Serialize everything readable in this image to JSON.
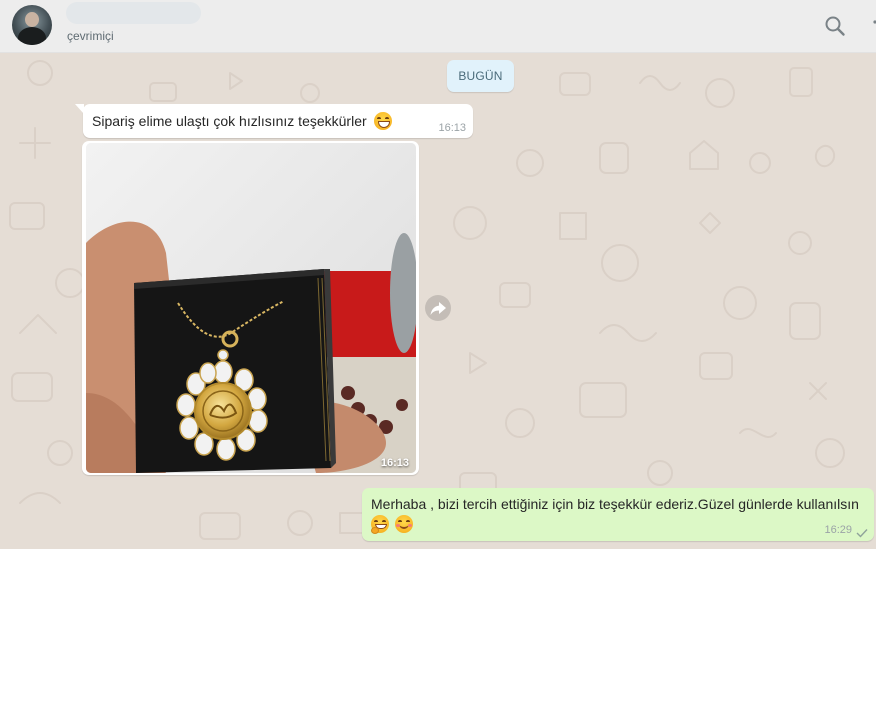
{
  "header": {
    "contact_status": "çevrimiçi",
    "search_icon": "search-icon",
    "menu_icon": "menu-icon"
  },
  "chat": {
    "date_label": "BUGÜN",
    "messages": [
      {
        "direction": "incoming",
        "type": "text",
        "text": "Sipariş elime ulaştı çok hızlısınız teşekkürler",
        "emoji": "grinning-face-icon",
        "time": "16:13"
      },
      {
        "direction": "incoming",
        "type": "image",
        "image_alt": "gold-pendant-necklace-in-box",
        "time": "16:13"
      },
      {
        "direction": "outgoing",
        "type": "text",
        "text": "Merhaba , bizi tercih ettiğiniz için biz teşekkür ederiz.Güzel günlerde kullanılsın",
        "emoji": [
          "hugging-face-icon",
          "smiling-face-icon"
        ],
        "time": "16:29",
        "status": "sent-check-icon"
      }
    ]
  },
  "colors": {
    "chat_background": "#e5ddd5",
    "incoming_bubble": "#ffffff",
    "outgoing_bubble": "#dcf8c6",
    "date_chip": "#e1f2fb",
    "header": "#ededed"
  }
}
